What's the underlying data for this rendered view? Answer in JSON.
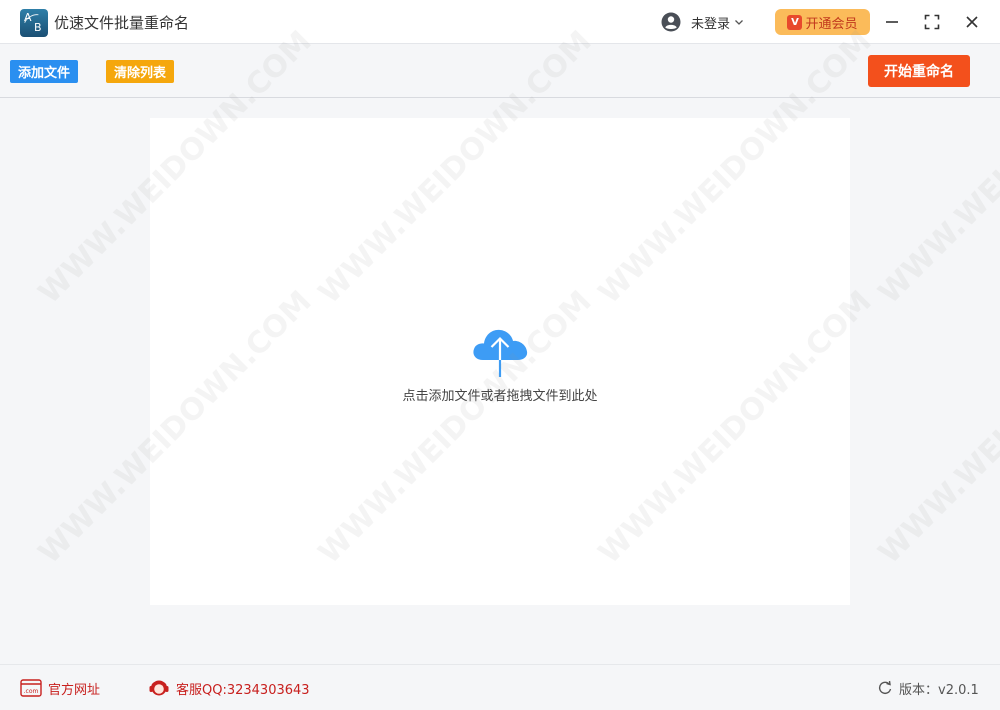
{
  "titlebar": {
    "app_title": "优速文件批量重命名",
    "logo_letters": [
      "A",
      "B"
    ],
    "user_label": "未登录",
    "vip_label": "开通会员",
    "vip_icon_letter": "V"
  },
  "toolbar": {
    "add_label": "添加文件",
    "clear_label": "清除列表",
    "start_label": "开始重命名"
  },
  "dropzone": {
    "hint": "点击添加文件或者拖拽文件到此处"
  },
  "footer": {
    "site_label": "官方网址",
    "site_icon_text": ".com",
    "qq_label": "客服QQ:3234303643",
    "version_label": "版本：v2.0.1"
  },
  "watermark": "WWW.WEIDOWN.COM",
  "colors": {
    "add_button": "#2a8ff0",
    "clear_button": "#f5a70d",
    "start_button": "#f3501c",
    "vip_button": "#fbbb5a",
    "upload_icon": "#3d9cf5",
    "footer_red": "#c8201e"
  },
  "icons": [
    "user-icon",
    "chevron-down-icon",
    "vip-icon",
    "minimize-icon",
    "maximize-icon",
    "close-icon",
    "cloud-upload-icon",
    "website-icon",
    "customer-service-icon",
    "refresh-icon"
  ]
}
